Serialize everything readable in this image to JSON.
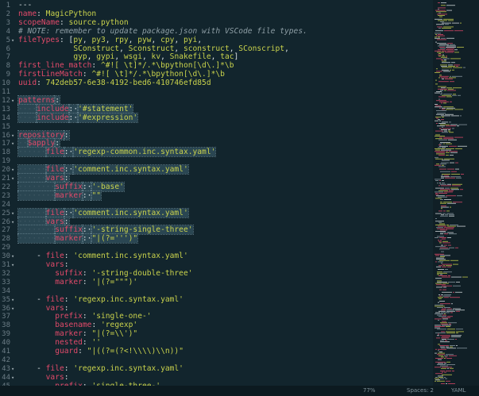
{
  "colors": {
    "background": "#12252d",
    "key": "#e24a6a",
    "string": "#c9d24c",
    "comment": "#8e9ea5",
    "punct": "#d8dfe2"
  },
  "fold_icon": "chevron-down-icon",
  "lines": [
    {
      "n": "1",
      "fold": "",
      "t": [
        [
          "p",
          "---"
        ]
      ]
    },
    {
      "n": "2",
      "fold": "",
      "t": [
        [
          "k",
          "name"
        ],
        [
          "p",
          ": "
        ],
        [
          "s",
          "MagicPython"
        ]
      ]
    },
    {
      "n": "3",
      "fold": "",
      "t": [
        [
          "k",
          "scopeName"
        ],
        [
          "p",
          ": "
        ],
        [
          "s",
          "source.python"
        ]
      ]
    },
    {
      "n": "4",
      "fold": "",
      "t": [
        [
          "c",
          "# NOTE: remember to update package.json with VSCode file types."
        ]
      ]
    },
    {
      "n": "5",
      "fold": "v",
      "t": [
        [
          "k",
          "fileTypes"
        ],
        [
          "p",
          ": ["
        ],
        [
          "s",
          "py"
        ],
        [
          "p",
          ", "
        ],
        [
          "s",
          "py3"
        ],
        [
          "p",
          ", "
        ],
        [
          "s",
          "rpy"
        ],
        [
          "p",
          ", "
        ],
        [
          "s",
          "pyw"
        ],
        [
          "p",
          ", "
        ],
        [
          "s",
          "cpy"
        ],
        [
          "p",
          ", "
        ],
        [
          "s",
          "pyi"
        ],
        [
          "p",
          ","
        ]
      ]
    },
    {
      "n": "6",
      "fold": "",
      "t": [
        [
          "p",
          "            "
        ],
        [
          "s",
          "SConstruct"
        ],
        [
          "p",
          ", "
        ],
        [
          "s",
          "Sconstruct"
        ],
        [
          "p",
          ", "
        ],
        [
          "s",
          "sconstruct"
        ],
        [
          "p",
          ", "
        ],
        [
          "s",
          "SConscript"
        ],
        [
          "p",
          ","
        ]
      ]
    },
    {
      "n": "7",
      "fold": "",
      "t": [
        [
          "p",
          "            "
        ],
        [
          "s",
          "gyp"
        ],
        [
          "p",
          ", "
        ],
        [
          "s",
          "gypi"
        ],
        [
          "p",
          ", "
        ],
        [
          "s",
          "wsgi"
        ],
        [
          "p",
          ", "
        ],
        [
          "s",
          "kv"
        ],
        [
          "p",
          ", "
        ],
        [
          "s",
          "Snakefile"
        ],
        [
          "p",
          ", "
        ],
        [
          "s",
          "tac"
        ],
        [
          "p",
          "]"
        ]
      ]
    },
    {
      "n": "8",
      "fold": "",
      "t": [
        [
          "k",
          "first_line_match"
        ],
        [
          "p",
          ": "
        ],
        [
          "s",
          "^#![ \\t]*/.*\\bpython[\\d\\.]*\\b"
        ]
      ]
    },
    {
      "n": "9",
      "fold": "",
      "t": [
        [
          "k",
          "firstLineMatch"
        ],
        [
          "p",
          ": "
        ],
        [
          "s",
          "^#![ \\t]*/.*\\bpython[\\d\\.]*\\b"
        ]
      ]
    },
    {
      "n": "10",
      "fold": "",
      "t": [
        [
          "k",
          "uuid"
        ],
        [
          "p",
          ": "
        ],
        [
          "s",
          "742deb57-6e38-4192-bed6-410746efd85d"
        ]
      ]
    },
    {
      "n": "11",
      "fold": "",
      "t": []
    },
    {
      "n": "12",
      "fold": "v",
      "t": [
        [
          "k",
          "patterns"
        ],
        [
          "p",
          ":"
        ]
      ],
      "sel": true
    },
    {
      "n": "13",
      "fold": "",
      "t": [
        [
          "ws",
          "··-·"
        ],
        [
          "k",
          "include"
        ],
        [
          "p",
          ":·"
        ],
        [
          "s",
          "'#statement'"
        ]
      ],
      "sel": true
    },
    {
      "n": "14",
      "fold": "",
      "t": [
        [
          "ws",
          "··-·"
        ],
        [
          "k",
          "include"
        ],
        [
          "p",
          ":·"
        ],
        [
          "s",
          "'#expression'"
        ]
      ],
      "sel": true
    },
    {
      "n": "15",
      "fold": "",
      "t": []
    },
    {
      "n": "16",
      "fold": "v",
      "t": [
        [
          "k",
          "repository"
        ],
        [
          "p",
          ":"
        ]
      ],
      "sel": true
    },
    {
      "n": "17",
      "fold": "v",
      "t": [
        [
          "ws",
          "··"
        ],
        [
          "k",
          "$apply"
        ],
        [
          "p",
          ":"
        ]
      ],
      "sel": true
    },
    {
      "n": "18",
      "fold": "",
      "t": [
        [
          "ws",
          "····-·"
        ],
        [
          "k",
          "file"
        ],
        [
          "p",
          ":·"
        ],
        [
          "s",
          "'regexp-common.inc.syntax.yaml'"
        ]
      ],
      "sel": true
    },
    {
      "n": "19",
      "fold": "",
      "t": []
    },
    {
      "n": "20",
      "fold": "v",
      "t": [
        [
          "ws",
          "····-·"
        ],
        [
          "k",
          "file"
        ],
        [
          "p",
          ":·"
        ],
        [
          "s",
          "'comment.inc.syntax.yaml'"
        ]
      ],
      "sel": true
    },
    {
      "n": "21",
      "fold": "v",
      "t": [
        [
          "ws",
          "······"
        ],
        [
          "k",
          "vars"
        ],
        [
          "p",
          ":"
        ]
      ],
      "sel": true
    },
    {
      "n": "22",
      "fold": "",
      "t": [
        [
          "ws",
          "········"
        ],
        [
          "k",
          "suffix"
        ],
        [
          "p",
          ":·"
        ],
        [
          "s",
          "'-base'"
        ]
      ],
      "sel": true
    },
    {
      "n": "23",
      "fold": "",
      "t": [
        [
          "ws",
          "········"
        ],
        [
          "k",
          "marker"
        ],
        [
          "p",
          ":·"
        ],
        [
          "s",
          "\"\""
        ]
      ],
      "sel": true
    },
    {
      "n": "24",
      "fold": "",
      "t": []
    },
    {
      "n": "25",
      "fold": "v",
      "t": [
        [
          "ws",
          "····-·"
        ],
        [
          "k",
          "file"
        ],
        [
          "p",
          ":·"
        ],
        [
          "s",
          "'comment.inc.syntax.yaml'"
        ]
      ],
      "sel": true
    },
    {
      "n": "26",
      "fold": "v",
      "t": [
        [
          "ws",
          "······"
        ],
        [
          "k",
          "vars"
        ],
        [
          "p",
          ":"
        ]
      ],
      "sel": true
    },
    {
      "n": "27",
      "fold": "",
      "t": [
        [
          "ws",
          "········"
        ],
        [
          "k",
          "suffix"
        ],
        [
          "p",
          ":·"
        ],
        [
          "s",
          "'-string-single-three'"
        ]
      ],
      "sel": true
    },
    {
      "n": "28",
      "fold": "",
      "t": [
        [
          "ws",
          "········"
        ],
        [
          "k",
          "marker"
        ],
        [
          "p",
          ":·"
        ],
        [
          "s",
          "\"|(?=''')\""
        ]
      ],
      "sel": true
    },
    {
      "n": "29",
      "fold": "",
      "t": []
    },
    {
      "n": "30",
      "fold": "v",
      "t": [
        [
          "p",
          "    - "
        ],
        [
          "k",
          "file"
        ],
        [
          "p",
          ": "
        ],
        [
          "s",
          "'comment.inc.syntax.yaml'"
        ]
      ]
    },
    {
      "n": "31",
      "fold": "v",
      "t": [
        [
          "p",
          "      "
        ],
        [
          "k",
          "vars"
        ],
        [
          "p",
          ":"
        ]
      ]
    },
    {
      "n": "32",
      "fold": "",
      "t": [
        [
          "p",
          "        "
        ],
        [
          "k",
          "suffix"
        ],
        [
          "p",
          ": "
        ],
        [
          "s",
          "'-string-double-three'"
        ]
      ]
    },
    {
      "n": "33",
      "fold": "",
      "t": [
        [
          "p",
          "        "
        ],
        [
          "k",
          "marker"
        ],
        [
          "p",
          ": "
        ],
        [
          "s",
          "'|(?=\"\"\")'"
        ]
      ]
    },
    {
      "n": "34",
      "fold": "",
      "t": []
    },
    {
      "n": "35",
      "fold": "v",
      "t": [
        [
          "p",
          "    - "
        ],
        [
          "k",
          "file"
        ],
        [
          "p",
          ": "
        ],
        [
          "s",
          "'regexp.inc.syntax.yaml'"
        ]
      ]
    },
    {
      "n": "36",
      "fold": "v",
      "t": [
        [
          "p",
          "      "
        ],
        [
          "k",
          "vars"
        ],
        [
          "p",
          ":"
        ]
      ]
    },
    {
      "n": "37",
      "fold": "",
      "t": [
        [
          "p",
          "        "
        ],
        [
          "k",
          "prefix"
        ],
        [
          "p",
          ": "
        ],
        [
          "s",
          "'single-one-'"
        ]
      ]
    },
    {
      "n": "38",
      "fold": "",
      "t": [
        [
          "p",
          "        "
        ],
        [
          "k",
          "basename"
        ],
        [
          "p",
          ": "
        ],
        [
          "s",
          "'regexp'"
        ]
      ]
    },
    {
      "n": "39",
      "fold": "",
      "t": [
        [
          "p",
          "        "
        ],
        [
          "k",
          "marker"
        ],
        [
          "p",
          ": "
        ],
        [
          "s",
          "\"|(?=\\\\')\""
        ]
      ]
    },
    {
      "n": "40",
      "fold": "",
      "t": [
        [
          "p",
          "        "
        ],
        [
          "k",
          "nested"
        ],
        [
          "p",
          ": "
        ],
        [
          "s",
          "''"
        ]
      ]
    },
    {
      "n": "41",
      "fold": "",
      "t": [
        [
          "p",
          "        "
        ],
        [
          "k",
          "guard"
        ],
        [
          "p",
          ": "
        ],
        [
          "s",
          "\"|((?=(?<!\\\\\\\\)\\\\n))\""
        ]
      ]
    },
    {
      "n": "42",
      "fold": "",
      "t": []
    },
    {
      "n": "43",
      "fold": "v",
      "t": [
        [
          "p",
          "    - "
        ],
        [
          "k",
          "file"
        ],
        [
          "p",
          ": "
        ],
        [
          "s",
          "'regexp.inc.syntax.yaml'"
        ]
      ]
    },
    {
      "n": "44",
      "fold": "v",
      "t": [
        [
          "p",
          "      "
        ],
        [
          "k",
          "vars"
        ],
        [
          "p",
          ":"
        ]
      ]
    },
    {
      "n": "45",
      "fold": "",
      "t": [
        [
          "p",
          "        "
        ],
        [
          "k",
          "prefix"
        ],
        [
          "p",
          ": "
        ],
        [
          "s",
          "'single-three-'"
        ]
      ]
    }
  ],
  "statusbar": {
    "zoom": "77%",
    "indent": "Spaces: 2",
    "syntax": "YAML"
  }
}
